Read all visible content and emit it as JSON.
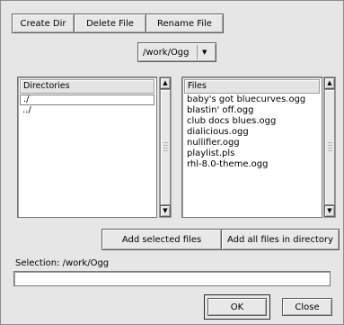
{
  "toolbar": {
    "create_dir_label": "Create Dir",
    "delete_file_label": "Delete File",
    "rename_file_label": "Rename File"
  },
  "path_selector": {
    "selected_value": "/work/Ogg",
    "arrow_glyph": "▼"
  },
  "directories": {
    "header": "Directories",
    "items": [
      "./",
      "../"
    ],
    "selected_index": 0
  },
  "files": {
    "header": "Files",
    "items": [
      "baby's got bluecurves.ogg",
      "blastin' off.ogg",
      "club docs blues.ogg",
      "dialicious.ogg",
      "nullifier.ogg",
      "playlist.pls",
      "rhl-8.0-theme.ogg"
    ]
  },
  "scrollbar": {
    "up_glyph": "▲",
    "down_glyph": "▼"
  },
  "actions": {
    "add_selected_label": "Add selected files",
    "add_all_label": "Add all files in directory"
  },
  "selection": {
    "label": "Selection: /work/Ogg",
    "value": ""
  },
  "dialog_buttons": {
    "ok_label": "OK",
    "close_label": "Close"
  },
  "colors": {
    "dialog_background": "#e6e6e6",
    "list_background": "#ffffff",
    "button_face": "#e8e8e8"
  }
}
